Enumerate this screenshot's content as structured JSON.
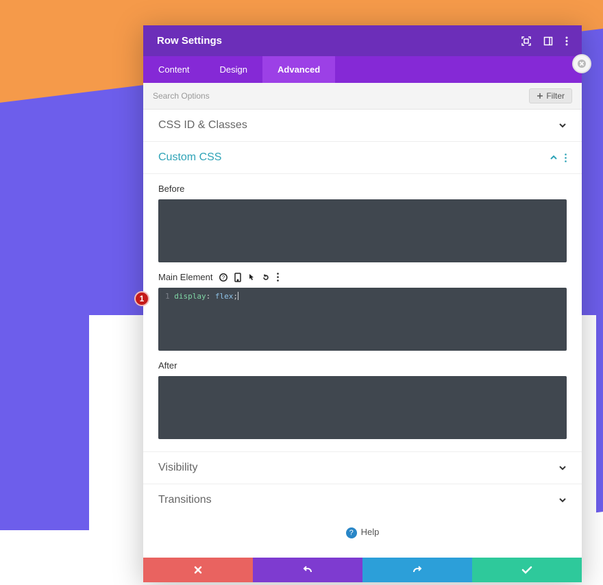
{
  "header": {
    "title": "Row Settings"
  },
  "tabs": [
    {
      "label": "Content"
    },
    {
      "label": "Design"
    },
    {
      "label": "Advanced"
    }
  ],
  "search": {
    "placeholder": "Search Options",
    "filter_label": "Filter"
  },
  "sections": {
    "cssid": {
      "title": "CSS ID & Classes"
    },
    "customcss": {
      "title": "Custom CSS",
      "before_label": "Before",
      "main_label": "Main Element",
      "after_label": "After",
      "code": {
        "line_number": "1",
        "property": "display",
        "value": "flex"
      }
    },
    "visibility": {
      "title": "Visibility"
    },
    "transitions": {
      "title": "Transitions"
    }
  },
  "help": {
    "label": "Help"
  },
  "marker": {
    "number": "1"
  }
}
